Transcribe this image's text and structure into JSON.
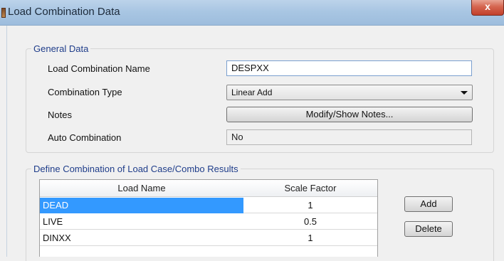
{
  "window": {
    "title": "Load Combination Data",
    "close_glyph": "x"
  },
  "general": {
    "legend": "General Data",
    "name_label": "Load Combination Name",
    "name_value": "DESPXX",
    "type_label": "Combination Type",
    "type_value": "Linear Add",
    "notes_label": "Notes",
    "notes_button": "Modify/Show Notes...",
    "auto_label": "Auto Combination",
    "auto_value": "No"
  },
  "define": {
    "legend": "Define Combination of Load Case/Combo Results",
    "columns": [
      "Load Name",
      "Scale Factor"
    ],
    "rows": [
      {
        "name": "DEAD",
        "factor": "1",
        "selected": true
      },
      {
        "name": "LIVE",
        "factor": "0.5",
        "selected": false
      },
      {
        "name": "DINXX",
        "factor": "1",
        "selected": false
      }
    ],
    "add_button": "Add",
    "delete_button": "Delete"
  },
  "colors": {
    "selection": "#3399ff",
    "legend_text": "#1f3d8a",
    "titlebar": "#a9c6e3",
    "close_button": "#c2402b"
  },
  "icons": {
    "app": "app-icon",
    "close": "close-icon",
    "dropdown": "chevron-down-icon"
  }
}
